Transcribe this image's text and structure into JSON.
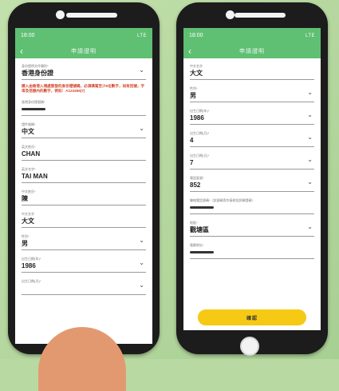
{
  "left_phone": {
    "status_time": "18:00",
    "status_signal": "LTE",
    "nav_title": "申請證明",
    "fields": [
      {
        "label": "身份證明文件類別*",
        "value": "香港身份證",
        "dropdown": true
      },
      {
        "label": "香港身份證號碼*",
        "value": "",
        "redacted": true
      },
      {
        "label": "證件號碼*",
        "value": "中文",
        "dropdown": true
      },
      {
        "label": "英文姓氏*",
        "value": "CHAN"
      },
      {
        "label": "英文名字*",
        "value": "TAI MAN"
      },
      {
        "label": "中文姓氏*",
        "value": "陳"
      },
      {
        "label": "中文名字",
        "value": "大文"
      },
      {
        "label": "性別*",
        "value": "男",
        "dropdown": true
      },
      {
        "label": "出生日期(年)*",
        "value": "1986",
        "dropdown": true
      },
      {
        "label": "出生日期(月)*",
        "value": "",
        "dropdown": true
      }
    ],
    "warning_note": "請入由香港入境處簽發的身份證號碼，必須填寫至少6位數字，如有括號，字母及括號內的數字，例如：A123456(7)"
  },
  "right_phone": {
    "status_time": "18:00",
    "status_signal": "LTE",
    "nav_title": "申請證明",
    "fields": [
      {
        "label": "中文名字",
        "value": "大文"
      },
      {
        "label": "性別*",
        "value": "男",
        "dropdown": true
      },
      {
        "label": "出生日期(年)*",
        "value": "1986",
        "dropdown": true
      },
      {
        "label": "出生日期(月)*",
        "value": "4",
        "dropdown": true
      },
      {
        "label": "出生日期(日)*",
        "value": "7",
        "dropdown": true
      },
      {
        "label": "電話區號*",
        "value": "852",
        "dropdown": true
      },
      {
        "label": "聯絡電話號碼*（該號碼用作接收短訊驗證碼）",
        "value": "",
        "redacted": true
      },
      {
        "label": "地區*",
        "value": "觀塘區",
        "dropdown": true
      },
      {
        "label": "電郵地址*",
        "value": "",
        "redacted": true
      }
    ],
    "confirm_label": "確認"
  }
}
